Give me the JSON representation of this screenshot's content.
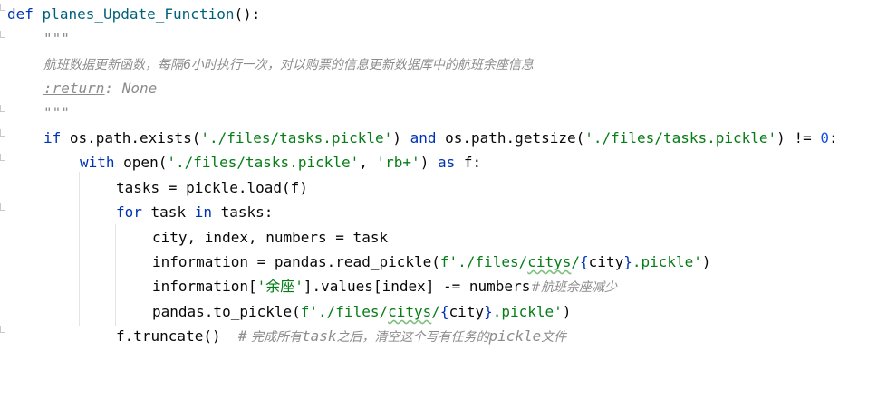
{
  "editor": {
    "lines": [
      {
        "kw_def": "def",
        "fn_name": "planes_Update_Function",
        "tail": "():"
      },
      {
        "doc": "\"\"\""
      },
      {
        "doc_zh": "航班数据更新函数，每隔6小时执行一次，对以购票的信息更新数据库中的航班余座信息"
      },
      {
        "doc_tag": ":return",
        "doc_rest": ": None"
      },
      {
        "doc": "\"\"\""
      },
      {
        "kw_if": "if",
        "p1": " os.path.exists(",
        "s1": "'./files/tasks.pickle'",
        "p2": ") ",
        "kw_and": "and",
        "p3": " os.path.getsize(",
        "s2": "'./files/tasks.pickle'",
        "p4": ") != ",
        "num": "0",
        "p5": ":"
      },
      {
        "kw_with": "with",
        "p1": " open(",
        "s1": "'./files/tasks.pickle'",
        "p2": ", ",
        "s2": "'rb+'",
        "p3": ") ",
        "kw_as": "as",
        "p4": " f:"
      },
      {
        "text": "tasks = pickle.load(f)"
      },
      {
        "kw_for": "for",
        "p1": " task ",
        "kw_in": "in",
        "p2": " tasks:"
      },
      {
        "text": "city, index, numbers = task"
      },
      {
        "p1": "information = pandas.read_pickle(",
        "s1": "f'./files/",
        "s1u": "citys",
        "s1b": "/",
        "br1": "{",
        "var": "city",
        "br2": "}",
        "s2": ".pickle'",
        "p2": ")"
      },
      {
        "p1": "information[",
        "s1": "'余座'",
        "p2": "].values[index] -= numbers",
        "cmt": "#航班余座减少"
      },
      {
        "p1": "pandas.to_pickle(",
        "s1": "f'./files/",
        "s1u": "citys",
        "s1b": "/",
        "br1": "{",
        "var": "city",
        "br2": "}",
        "s2": ".pickle'",
        "p2": ")"
      },
      {
        "p1": "f.truncate()  ",
        "cmt_hash": "#",
        "cmt1": " 完成所有",
        "cmt_task": "task",
        "cmt2": "之后，清空这个写有任务的",
        "cmt_pickle": "pickle",
        "cmt3": "文件"
      }
    ]
  },
  "colors": {
    "keyword": "#0033b3",
    "function_name": "#00627a",
    "string": "#067d17",
    "number": "#1750eb",
    "comment": "#8c8c8c"
  }
}
